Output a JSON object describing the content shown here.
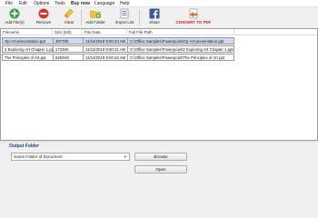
{
  "menu": [
    "File",
    "Edit",
    "Options",
    "Tools",
    "Buy now",
    "Language",
    "Help"
  ],
  "toolbar": {
    "add_files": "Add File(s)",
    "remove": "Remove",
    "clear": "Clear",
    "add_folder": "Add Folder",
    "import_list": "Import List",
    "share": "Share",
    "convert": "CONVERT TO PDF"
  },
  "file_list": {
    "columns": [
      "Filename",
      "Size (KB)",
      "File Date",
      "Full File Path"
    ],
    "rows": [
      [
        "Op-Art-presentation.ppt",
        "287780",
        "11/13/2018 9:00:43 AM",
        "C:\\Office Samples\\Powerpoint\\Op-Art-presentation.ppt"
      ],
      [
        "2 Exploring Art Chapter 1.ppt",
        "172480",
        "11/13/2018 9:00:42 AM",
        "C:\\Office Samples\\Powerpoint\\2 Exploring Art Chapter 1.ppt"
      ],
      [
        "The Principles of Art.ppt",
        "6294K8",
        "11/13/2018 9:00:43 AM",
        "C:\\Office Samples\\Powerpoint\\The Principles of Art.ppt"
      ]
    ]
  },
  "output": {
    "label": "Output Folder",
    "selected": "Same Folder of Document",
    "browse": "Browse",
    "open": "Open"
  },
  "colors": {
    "selected_row": "#cfd9f5",
    "output_label": "#1a3f7a",
    "convert_label": "#d42020",
    "add_icon": "#2fa83a",
    "remove_icon": "#d9362b"
  },
  "icons": [
    "add-icon",
    "remove-icon",
    "clear-icon",
    "add-folder-icon",
    "import-list-icon",
    "share-icon",
    "convert-pdf-icon"
  ]
}
